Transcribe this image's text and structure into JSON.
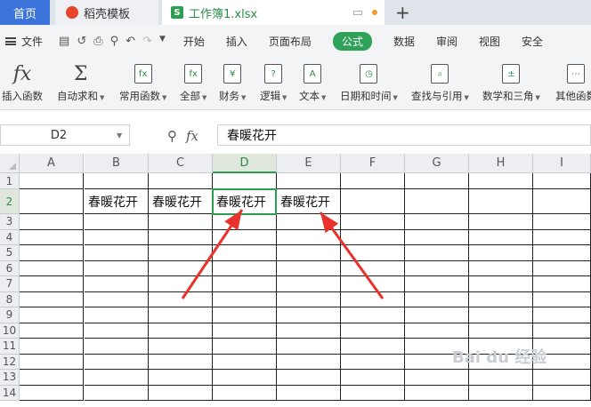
{
  "tabs": {
    "home": "首页",
    "docer": "稻壳模板",
    "file_icon": "S",
    "file": "工作簿1.xlsx",
    "add": "+"
  },
  "menu": {
    "file_label": "文件",
    "items": [
      "开始",
      "插入",
      "页面布局",
      "公式",
      "数据",
      "审阅",
      "视图",
      "安全"
    ],
    "active": "公式"
  },
  "ribbon": {
    "items": [
      {
        "label": "插入函数",
        "icon": "fx-icon",
        "caret": false
      },
      {
        "label": "自动求和",
        "icon": "sigma-icon",
        "caret": true
      },
      {
        "label": "常用函数",
        "icon": "common-functions-icon",
        "caret": true
      },
      {
        "label": "全部",
        "icon": "all-functions-icon",
        "caret": true
      },
      {
        "label": "财务",
        "icon": "finance-icon",
        "caret": true
      },
      {
        "label": "逻辑",
        "icon": "logic-icon",
        "caret": true
      },
      {
        "label": "文本",
        "icon": "text-icon",
        "caret": true
      },
      {
        "label": "日期和时间",
        "icon": "datetime-icon",
        "caret": true
      },
      {
        "label": "查找与引用",
        "icon": "lookup-icon",
        "caret": true
      },
      {
        "label": "数学和三角",
        "icon": "math-icon",
        "caret": true
      },
      {
        "label": "其他函数",
        "icon": "other-functions-icon",
        "caret": false
      }
    ]
  },
  "formula_bar": {
    "name_box": "D2",
    "fx_label": "fx",
    "formula": "春暖花开"
  },
  "sheet": {
    "columns": [
      "A",
      "B",
      "C",
      "D",
      "E",
      "F",
      "G",
      "H",
      "I"
    ],
    "rows": [
      "1",
      "2",
      "3",
      "4",
      "5",
      "6",
      "7",
      "8",
      "9",
      "10",
      "11",
      "12",
      "13",
      "14"
    ],
    "selected_column": "D",
    "selected_row": "2",
    "row2": [
      "",
      "春暖花开",
      "春暖花开",
      "春暖花开",
      "春暖花开",
      "",
      "",
      "",
      ""
    ]
  },
  "colors": {
    "accent": "#2fa25a",
    "home_tab": "#3d74db",
    "arrow": "#e8322b"
  },
  "watermark": "Bai du 经验"
}
